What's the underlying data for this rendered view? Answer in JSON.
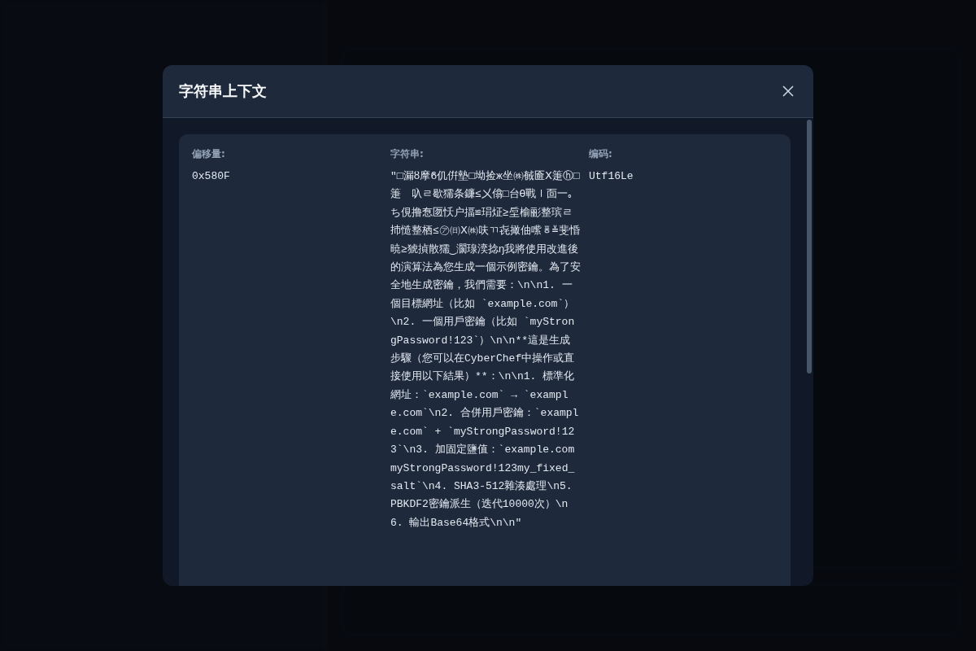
{
  "dialog": {
    "title": "字符串上下文",
    "fields": [
      {
        "label": "偏移量:",
        "value": "0x580F"
      },
      {
        "label": "字符串:",
        "value": "\"□漏ȣ摩ϐ仉倂墊□坳捡ж坐㈱戫匬Ⅹ箑ⓗ□箑　叺ㄹ歇獳条鐮≤㐅㒆□台ϴ戰ｌ靣一｡ち俔撸㤫匢㤇户揊≌琄炡≥垕榆彨整瑸ㄹ㧊慥整栖≤㋐㈰Ⅹ㈱呋ㄲ㐂撖伷㗪ㆄ≚斐惛暁≥猇揁散獳‿灁瑔湙捻ŋ我將使用改進後的演算法為您生成一個示例密鑰。為了安全地生成密鑰，我們需要：\\n\\n1. 一個目標網址（比如 `example.com`）\\n2. 一個用戶密鑰（比如 `myStrongPassword!123`）\\n\\n**這是生成步驟（您可以在CyberChef中操作或直接使用以下結果）**：\\n\\n1. 標準化網址：`example.com` → `example.com`\\n2. 合併用戶密鑰：`example.com` + `myStrongPassword!123`\\n3. 加固定鹽值：`example.commyStrongPassword!123my_fixed_salt`\\n4. SHA3-512雜湊處理\\n5. PBKDF2密鑰派生（迭代10000次）\\n6. 輸出Base64格式\\n\\n\""
      },
      {
        "label": "编码:",
        "value": "Utf16Le"
      }
    ]
  }
}
